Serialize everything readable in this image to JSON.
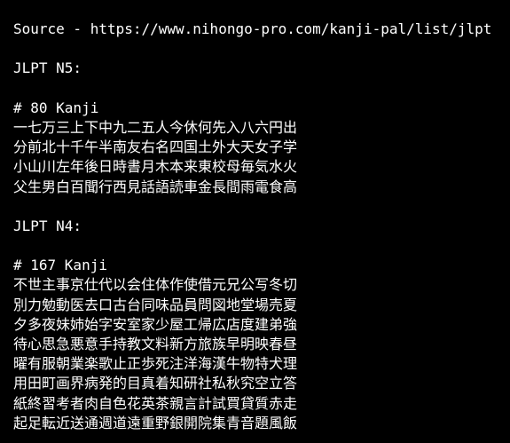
{
  "lines": [
    {
      "text": "Source - https://www.nihongo-pro.com/kanji-pal/list/jlpt",
      "kanji": false
    },
    {
      "text": "",
      "kanji": false
    },
    {
      "text": "JLPT N5:",
      "kanji": false
    },
    {
      "text": "",
      "kanji": false
    },
    {
      "text": "# 80 Kanji",
      "kanji": false
    },
    {
      "text": "一七万三上下中九二五人今休何先入八六円出",
      "kanji": true
    },
    {
      "text": "分前北十千午半南友右名四国土外大天女子学",
      "kanji": true
    },
    {
      "text": "小山川左年後日時書月木本来東校母毎気水火",
      "kanji": true
    },
    {
      "text": "父生男白百聞行西見話語読車金長間雨電食高",
      "kanji": true
    },
    {
      "text": "",
      "kanji": false
    },
    {
      "text": "JLPT N4:",
      "kanji": false
    },
    {
      "text": "",
      "kanji": false
    },
    {
      "text": "# 167 Kanji",
      "kanji": false
    },
    {
      "text": "不世主事京仕代以会住体作使借元兄公写冬切",
      "kanji": true
    },
    {
      "text": "別力勉動医去口古台同味品員問図地堂場売夏",
      "kanji": true
    },
    {
      "text": "夕多夜妹姉始字安室家少屋工帰広店度建弟強",
      "kanji": true
    },
    {
      "text": "待心思急悪意手持教文料新方旅族早明映春昼",
      "kanji": true
    },
    {
      "text": "曜有服朝業楽歌止正歩死注洋海漢牛物特犬理",
      "kanji": true
    },
    {
      "text": "用田町画界病発的目真着知研社私秋究空立答",
      "kanji": true
    },
    {
      "text": "紙終習考者肉自色花英茶親言計試買貸質赤走",
      "kanji": true
    },
    {
      "text": "起足転近送通週道遠重野銀開院集青音題風飯",
      "kanji": true
    }
  ]
}
